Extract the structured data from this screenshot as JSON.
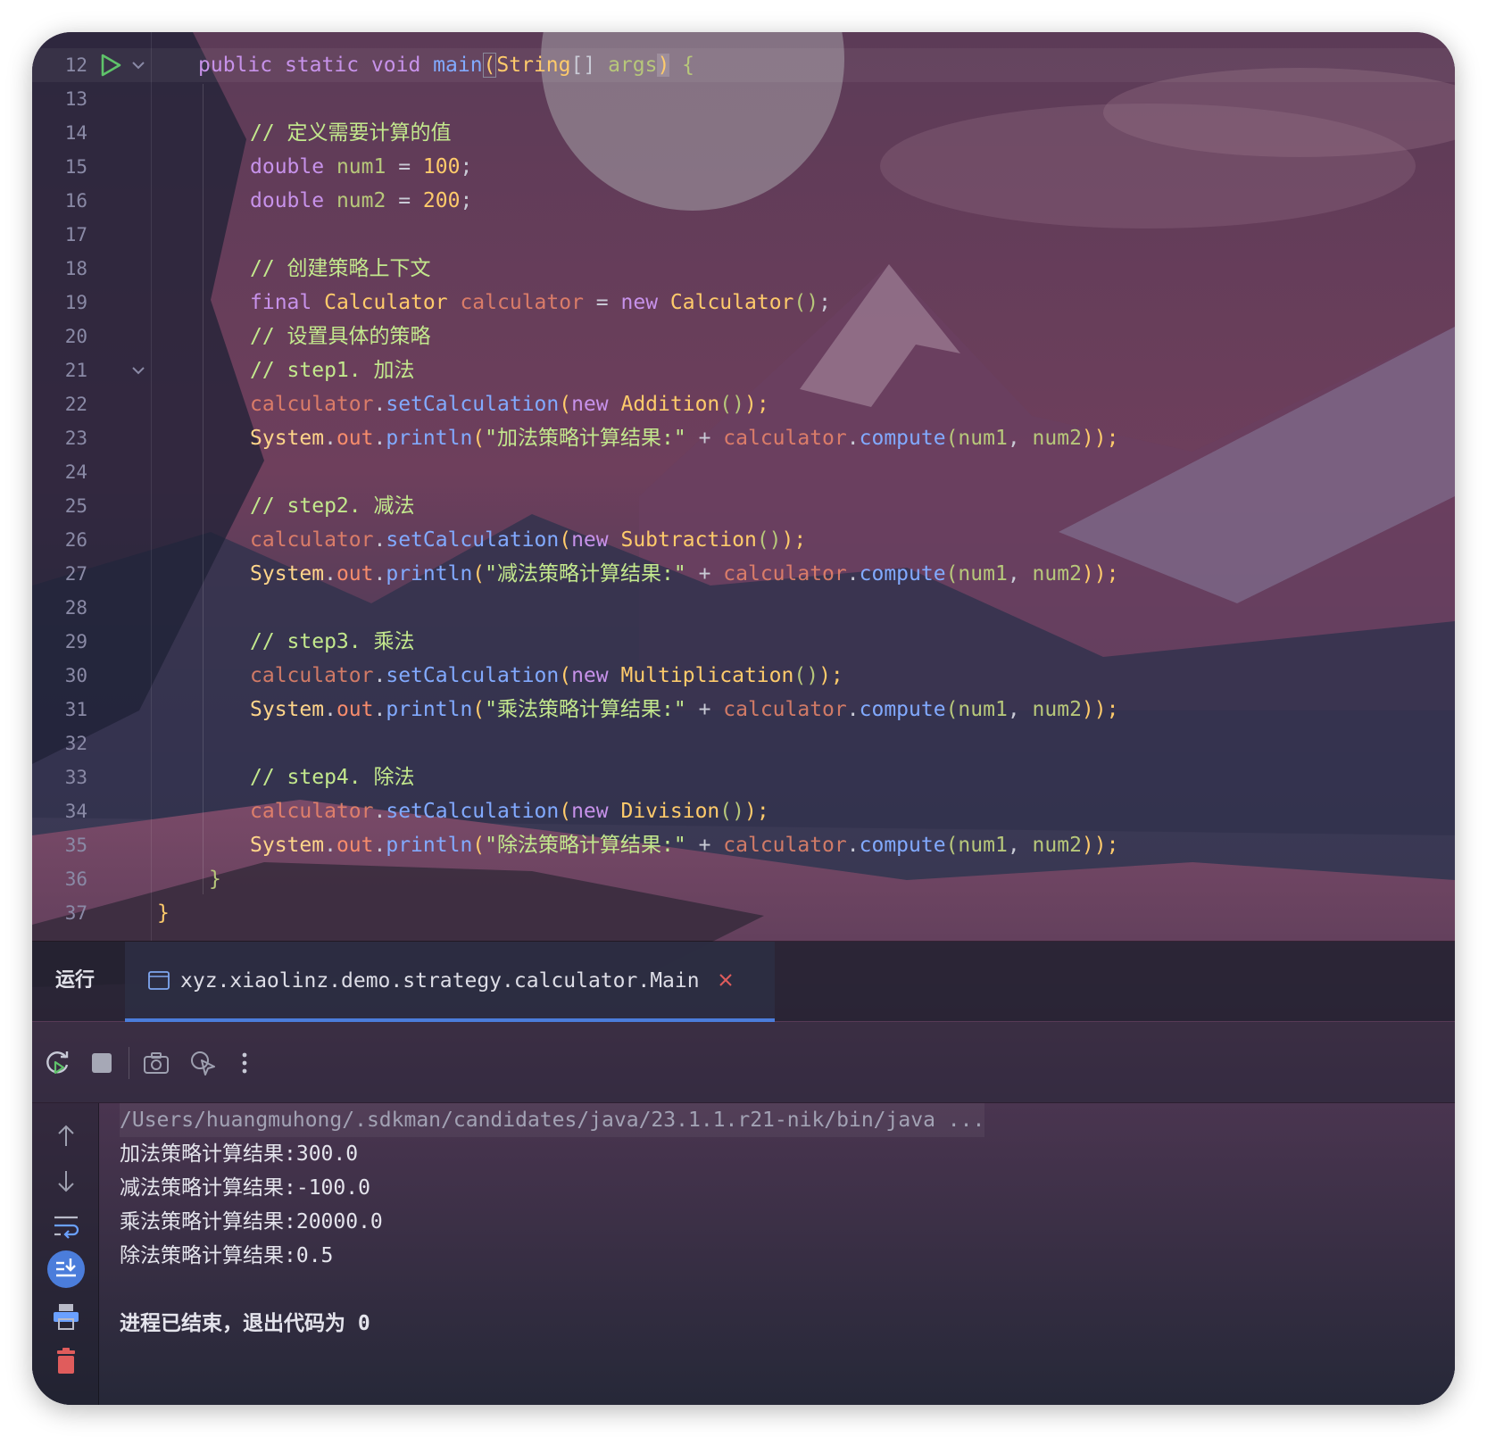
{
  "editor": {
    "line_numbers": [
      "12",
      "13",
      "14",
      "15",
      "16",
      "17",
      "18",
      "19",
      "20",
      "21",
      "22",
      "23",
      "24",
      "25",
      "26",
      "27",
      "28",
      "29",
      "30",
      "31",
      "32",
      "33",
      "34",
      "35",
      "36",
      "37"
    ],
    "code": {
      "l12": {
        "kw_public": "public",
        "kw_static": "static",
        "kw_void": "void",
        "fn_main": "main",
        "paren_open": "(",
        "cls_string": "String",
        "brackets": "[]",
        "param_args": "args",
        "paren_close": ")",
        "brace": "{"
      },
      "l14": "// 定义需要计算的值",
      "l15": {
        "kw": "double",
        "var": "num1",
        "eq": "=",
        "num": "100",
        "semi": ";"
      },
      "l16": {
        "kw": "double",
        "var": "num2",
        "eq": "=",
        "num": "200",
        "semi": ";"
      },
      "l18": "// 创建策略上下文",
      "l19": {
        "kw_final": "final",
        "cls": "Calculator",
        "var": "calculator",
        "eq": "=",
        "kw_new": "new",
        "cls2": "Calculator",
        "parens": "()",
        "semi": ";"
      },
      "l20": "// 设置具体的策略",
      "l21": "// step1. 加法",
      "l22": {
        "obj": "calculator",
        "dot": ".",
        "fn": "setCalculation",
        "open": "(",
        "kw_new": "new",
        "cls": "Addition",
        "inner": "()",
        "close": ");"
      },
      "l23": {
        "sys": "System",
        "dot1": ".",
        "out": "out",
        "dot2": ".",
        "fn": "println",
        "open": "(",
        "str": "\"加法策略计算结果:\"",
        "plus": "+",
        "obj": "calculator",
        "dot3": ".",
        "fn2": "compute",
        "open2": "(",
        "a": "num1",
        "comma": ",",
        "b": "num2",
        "close": "));"
      },
      "l25": "// step2. 减法",
      "l26": {
        "obj": "calculator",
        "dot": ".",
        "fn": "setCalculation",
        "open": "(",
        "kw_new": "new",
        "cls": "Subtraction",
        "inner": "()",
        "close": ");"
      },
      "l27": {
        "sys": "System",
        "dot1": ".",
        "out": "out",
        "dot2": ".",
        "fn": "println",
        "open": "(",
        "str": "\"减法策略计算结果:\"",
        "plus": "+",
        "obj": "calculator",
        "dot3": ".",
        "fn2": "compute",
        "open2": "(",
        "a": "num1",
        "comma": ",",
        "b": "num2",
        "close": "));"
      },
      "l29": "// step3. 乘法",
      "l30": {
        "obj": "calculator",
        "dot": ".",
        "fn": "setCalculation",
        "open": "(",
        "kw_new": "new",
        "cls": "Multiplication",
        "inner": "()",
        "close": ");"
      },
      "l31": {
        "sys": "System",
        "dot1": ".",
        "out": "out",
        "dot2": ".",
        "fn": "println",
        "open": "(",
        "str": "\"乘法策略计算结果:\"",
        "plus": "+",
        "obj": "calculator",
        "dot3": ".",
        "fn2": "compute",
        "open2": "(",
        "a": "num1",
        "comma": ",",
        "b": "num2",
        "close": "));"
      },
      "l33": "// step4. 除法",
      "l34": {
        "obj": "calculator",
        "dot": ".",
        "fn": "setCalculation",
        "open": "(",
        "kw_new": "new",
        "cls": "Division",
        "inner": "()",
        "close": ");"
      },
      "l35": {
        "sys": "System",
        "dot1": ".",
        "out": "out",
        "dot2": ".",
        "fn": "println",
        "open": "(",
        "str": "\"除法策略计算结果:\"",
        "plus": "+",
        "obj": "calculator",
        "dot3": ".",
        "fn2": "compute",
        "open2": "(",
        "a": "num1",
        "comma": ",",
        "b": "num2",
        "close": "));"
      },
      "l36": "}",
      "l37": "}"
    }
  },
  "run_panel": {
    "label": "运行",
    "tab_title": "xyz.xiaolinz.demo.strategy.calculator.Main",
    "toolbar_icons": [
      "rerun-icon",
      "stop-icon",
      "camera-icon",
      "pointer-icon",
      "more-vertical-icon"
    ],
    "side_icons": [
      "arrow-up-icon",
      "arrow-down-icon",
      "soft-wrap-icon",
      "scroll-to-end-icon",
      "print-icon",
      "trash-icon"
    ],
    "console": {
      "command": "/Users/huangmuhong/.sdkman/candidates/java/23.1.1.r21-nik/bin/java ...",
      "lines": [
        "加法策略计算结果:300.0",
        "减法策略计算结果:-100.0",
        "乘法策略计算结果:20000.0",
        "除法策略计算结果:0.5"
      ],
      "exit_message": "进程已结束，退出代码为 0"
    }
  },
  "colors": {
    "accent": "#4b7ddb",
    "keyword": "#c792ea",
    "function": "#82aaff",
    "class": "#ffcb6b",
    "string": "#c3e88d",
    "close": "#e05c5c"
  }
}
